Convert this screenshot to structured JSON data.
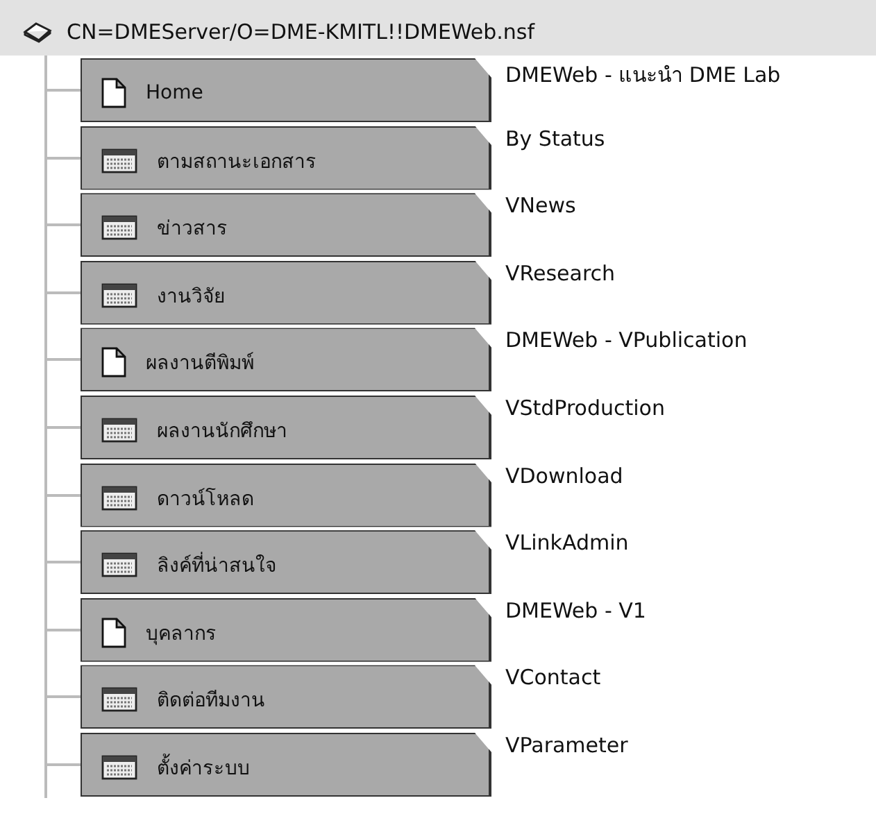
{
  "database": {
    "title": "CN=DMEServer/O=DME-KMITL!!DMEWeb.nsf"
  },
  "entries": [
    {
      "kind": "page",
      "label": "Home",
      "target": "DMEWeb - แนะนำ DME Lab"
    },
    {
      "kind": "view",
      "label": "ตามสถานะเอกสาร",
      "target": "By Status"
    },
    {
      "kind": "view",
      "label": "ข่าวสาร",
      "target": "VNews"
    },
    {
      "kind": "view",
      "label": "งานวิจัย",
      "target": "VResearch"
    },
    {
      "kind": "page",
      "label": "ผลงานตีพิมพ์",
      "target": "DMEWeb - VPublication"
    },
    {
      "kind": "view",
      "label": "ผลงานนักศึกษา",
      "target": "VStdProduction"
    },
    {
      "kind": "view",
      "label": "ดาวน์โหลด",
      "target": "VDownload"
    },
    {
      "kind": "view",
      "label": "ลิงค์ที่น่าสนใจ",
      "target": "VLinkAdmin"
    },
    {
      "kind": "page",
      "label": "บุคลากร",
      "target": "DMEWeb - V1"
    },
    {
      "kind": "view",
      "label": "ติดต่อทีมงาน",
      "target": "VContact"
    },
    {
      "kind": "view",
      "label": "ตั้งค่าระบบ",
      "target": "VParameter"
    }
  ]
}
